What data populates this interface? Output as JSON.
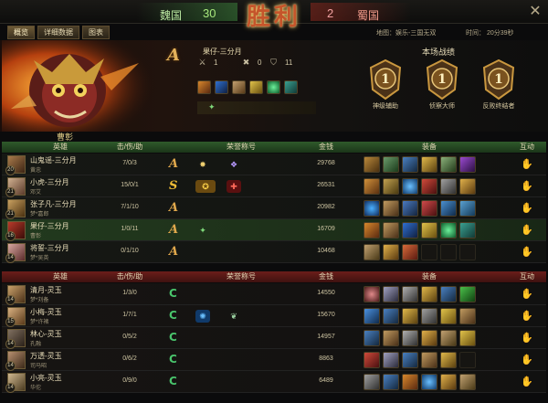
{
  "header": {
    "team_wei": "魏国",
    "score_wei": "30",
    "result": "胜利",
    "score_shu": "2",
    "team_shu": "蜀国",
    "close_icon": "close-icon"
  },
  "tabs": [
    {
      "label": "概览",
      "active": true
    },
    {
      "label": "详细数据",
      "active": false
    },
    {
      "label": "图表",
      "active": false
    }
  ],
  "match_info": {
    "map": "地图：娱乐-三国无双",
    "time": "时间： 20分39秒"
  },
  "summary": {
    "grade": "A",
    "player_name": "果仔-三分月",
    "kills": "1",
    "deaths": "0",
    "assists": "11",
    "hero_name": "曹彰",
    "stats_title": "本场战绩",
    "medals": [
      {
        "label": "神级辅助",
        "icon": "medal-icon"
      },
      {
        "label": "侦察大师",
        "icon": "medal-icon"
      },
      {
        "label": "反败终结者",
        "icon": "medal-icon"
      }
    ]
  },
  "columns": {
    "hero": "英雄",
    "kda": "击/伤/助",
    "honor": "荣誉称号",
    "gold": "金钱",
    "equip": "装备",
    "interact": "互动"
  },
  "team_wei_rows": [
    {
      "player": "山鬼谣-三分月",
      "level": "20",
      "hero": "黄忠",
      "kda": "7/0/3",
      "grade": "A",
      "gold": "29768",
      "honors": 2
    },
    {
      "player": "小虎-三分月",
      "level": "21",
      "hero": "邓艾",
      "kda": "15/0/1",
      "grade": "S",
      "gold": "26531",
      "honors": 2
    },
    {
      "player": "张子凡-三分月",
      "level": "21",
      "hero": "梦*嘉郎",
      "kda": "7/1/10",
      "grade": "A",
      "gold": "20982",
      "honors": 0
    },
    {
      "player": "果仔-三分月",
      "level": "16",
      "hero": "曹彰",
      "kda": "1/0/11",
      "grade": "A",
      "gold": "16709",
      "honors": 1
    },
    {
      "player": "将誓-三分月",
      "level": "14",
      "hero": "梦*吴英",
      "kda": "0/1/10",
      "grade": "A",
      "gold": "10468",
      "honors": 0
    }
  ],
  "team_shu_rows": [
    {
      "player": "清月-灵玉",
      "level": "14",
      "hero": "梦*刘备",
      "kda": "1/3/0",
      "grade": "C",
      "gold": "14550",
      "honors": 0
    },
    {
      "player": "小梅-灵玉",
      "level": "15",
      "hero": "梦*许褚",
      "kda": "1/7/1",
      "grade": "C",
      "gold": "15670",
      "honors": 2
    },
    {
      "player": "林心-灵玉",
      "level": "14",
      "hero": "孔融",
      "kda": "0/5/2",
      "grade": "C",
      "gold": "14957",
      "honors": 0
    },
    {
      "player": "万透-灵玉",
      "level": "14",
      "hero": "司马昭",
      "kda": "0/6/2",
      "grade": "C",
      "gold": "8863",
      "honors": 0
    },
    {
      "player": "小亮-灵玉",
      "level": "14",
      "hero": "华佗",
      "kda": "0/9/0",
      "grade": "C",
      "gold": "6489",
      "honors": 0
    }
  ],
  "colors": {
    "wei": "#2f5a2b",
    "shu": "#6b1e1a",
    "gold_accent": "#e3b25a"
  }
}
